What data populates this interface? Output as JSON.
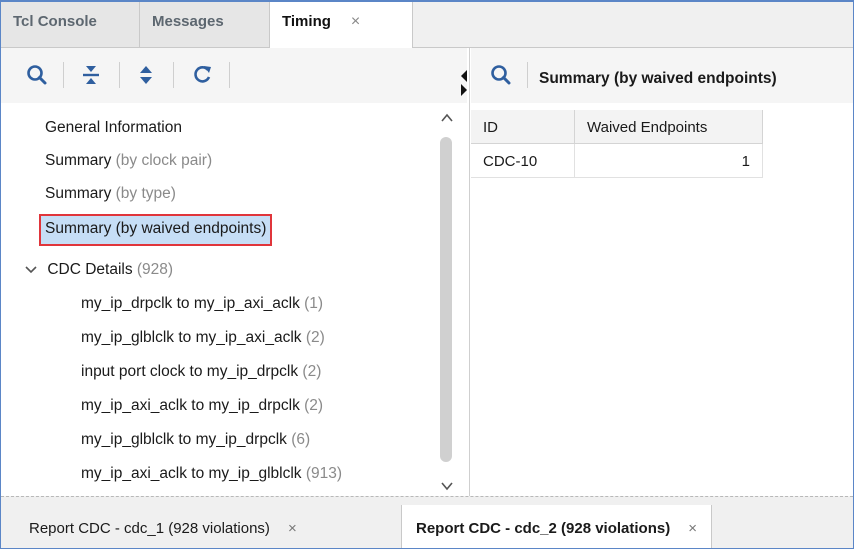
{
  "top_tabs": [
    {
      "label": "Tcl Console"
    },
    {
      "label": "Messages"
    },
    {
      "label": "Timing",
      "close": "×"
    }
  ],
  "toolbar": {
    "icons": [
      "search-icon",
      "collapse-all-icon",
      "expand-all-icon",
      "refresh-icon"
    ]
  },
  "tree": {
    "items": [
      {
        "label": "General Information"
      },
      {
        "label": "Summary",
        "suffix": "(by clock pair)"
      },
      {
        "label": "Summary",
        "suffix": "(by type)"
      },
      {
        "label": "Summary (by waived endpoints)",
        "selected": true
      },
      {
        "label": "CDC Details",
        "suffix": "(928)"
      }
    ],
    "children": [
      {
        "label": "my_ip_drpclk to my_ip_axi_aclk",
        "count": "(1)"
      },
      {
        "label": "my_ip_glblclk to my_ip_axi_aclk",
        "count": "(2)"
      },
      {
        "label": "input port clock to my_ip_drpclk",
        "count": "(2)"
      },
      {
        "label": "my_ip_axi_aclk to my_ip_drpclk",
        "count": "(2)"
      },
      {
        "label": "my_ip_glblclk to my_ip_drpclk",
        "count": "(6)"
      },
      {
        "label": "my_ip_axi_aclk to my_ip_glblclk",
        "count": "(913)"
      }
    ]
  },
  "right_panel": {
    "title": "Summary (by waived endpoints)",
    "columns": [
      "ID",
      "Waived Endpoints"
    ],
    "rows": [
      [
        "CDC-10",
        "1"
      ]
    ]
  },
  "bottom_tabs": [
    {
      "label": "Report CDC - cdc_1 (928 violations)",
      "close": "×"
    },
    {
      "label": "Report CDC - cdc_2 (928 violations)",
      "close": "×",
      "active": true
    }
  ],
  "colors": {
    "accent_border": "#5b86c7",
    "selection": "#c6def6",
    "highlight_box": "#e0353b",
    "icon_blue": "#2f5f9f"
  }
}
